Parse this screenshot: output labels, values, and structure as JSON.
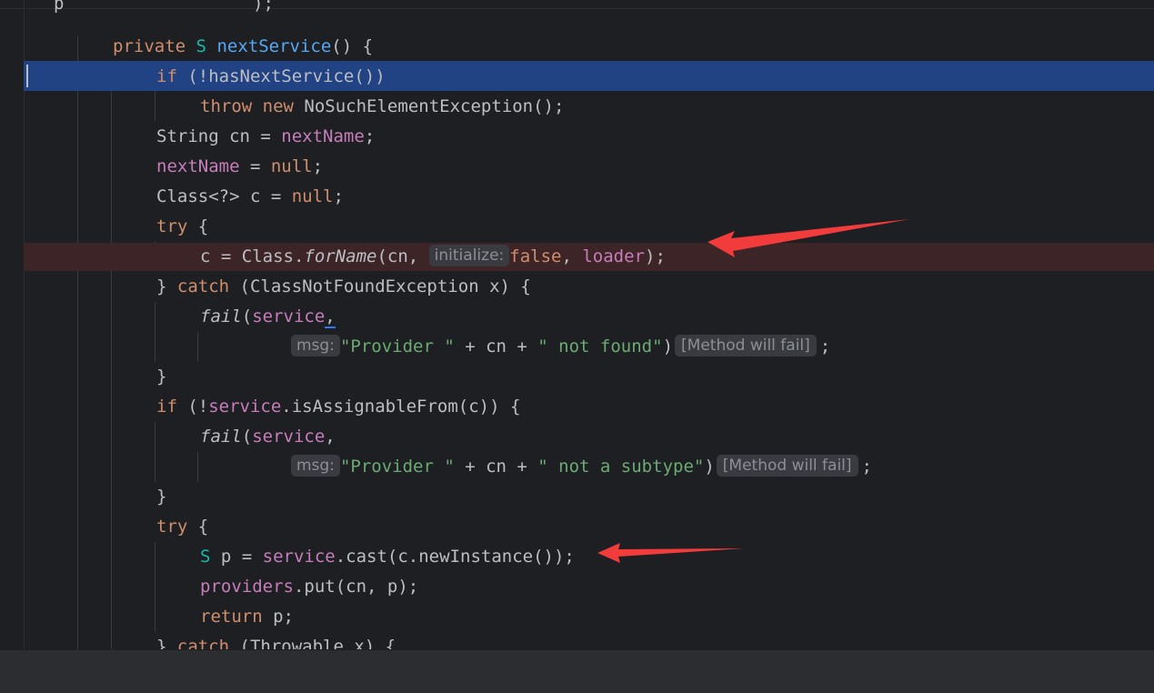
{
  "editor": {
    "top_fragment": {
      "p": "p",
      "close": ");"
    },
    "lines": {
      "l1": {
        "kw": "private",
        "type": "S",
        "method": "nextService",
        "rest": "() {"
      },
      "l2": {
        "kw": "if",
        "rest": " (!hasNextService())"
      },
      "l3": {
        "kw1": "throw",
        "kw2": "new",
        "rest": " NoSuchElementException();"
      },
      "l4": {
        "pre": "String cn = ",
        "field": "nextName",
        "rest": ";"
      },
      "l5": {
        "field": "nextName",
        "mid": " = ",
        "kw": "null",
        "rest": ";"
      },
      "l6": {
        "pre": "Class<?> c = ",
        "kw": "null",
        "rest": ";"
      },
      "l7": {
        "kw": "try",
        "rest": " {"
      },
      "l8": {
        "pre": "c = Class.",
        "method": "forName",
        "mid": "(cn, ",
        "hint": "initialize:",
        "kw": "false",
        "sep": ", ",
        "field": "loader",
        "rest": ");"
      },
      "l9": {
        "pre": "} ",
        "kw": "catch",
        "rest": " (ClassNotFoundException x) {"
      },
      "l10": {
        "method": "fail",
        "open": "(",
        "field": "service",
        "comma": ","
      },
      "l11": {
        "hint": "msg:",
        "str1": "\"Provider \"",
        "mid": " + cn + ",
        "str2": "\" not found\"",
        "close": ")",
        "badge": "[Method will fail]",
        "end": ";"
      },
      "l12": {
        "text": "}"
      },
      "l13": {
        "kw": "if",
        "pre": " (!",
        "field": "service",
        "rest": ".isAssignableFrom(c)) {"
      },
      "l14": {
        "method": "fail",
        "open": "(",
        "field": "service",
        "comma": ","
      },
      "l15": {
        "hint": "msg:",
        "str1": "\"Provider \"",
        "mid": " + cn + ",
        "str2": "\" not a subtype\"",
        "close": ")",
        "badge": "[Method will fail]",
        "end": ";"
      },
      "l16": {
        "text": "}"
      },
      "l17": {
        "kw": "try",
        "rest": " {"
      },
      "l18": {
        "type": "S",
        "pre": " p = ",
        "field": "service",
        "rest": ".cast(c.newInstance());"
      },
      "l19": {
        "field": "providers",
        "rest": ".put(cn, p);"
      },
      "l20": {
        "kw": "return",
        "rest": " p;"
      },
      "l21": {
        "pre": "} ",
        "kw": "catch",
        "rest": " (Throwable x) {"
      }
    }
  },
  "colors": {
    "background": "#1e1f22",
    "execution_line": "#214283",
    "breakpoint_line": "#3d2426",
    "keyword": "#cf8e6d",
    "type_param": "#16baac",
    "method_decl": "#56a8f5",
    "field": "#c77dbb",
    "string": "#6aab73",
    "annotation_arrow": "#f23c3c"
  }
}
